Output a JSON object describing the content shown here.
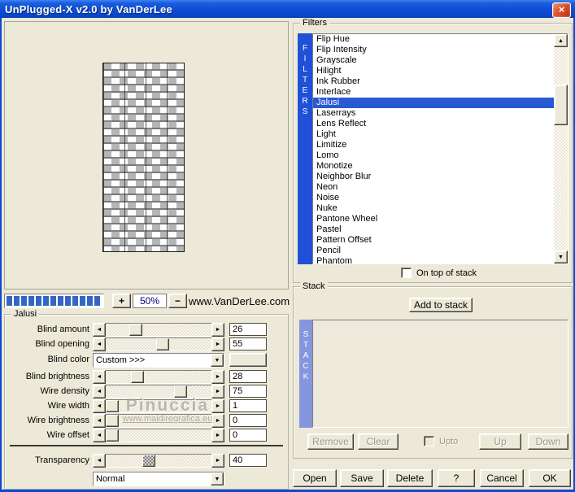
{
  "window": {
    "title": "UnPlugged-X v2.0 by VanDerLee",
    "close_glyph": "×"
  },
  "preview": {
    "zoom_in_label": "+",
    "zoom_out_label": "−",
    "zoom_value": "50%",
    "website": "www.VanDerLee.com",
    "progress_percent": 100
  },
  "filters": {
    "legend": "Filters",
    "sidebar_letters": [
      "F",
      "I",
      "L",
      "T",
      "E",
      "R",
      "S"
    ],
    "items": [
      "Flip Hue",
      "Flip Intensity",
      "Grayscale",
      "Hilight",
      "Ink Rubber",
      "Interlace",
      "Jalusi",
      "Laserrays",
      "Lens Reflect",
      "Light",
      "Limitize",
      "Lomo",
      "Monotize",
      "Neighbor Blur",
      "Neon",
      "Noise",
      "Nuke",
      "Pantone Wheel",
      "Pastel",
      "Pattern Offset",
      "Pencil",
      "Phantom"
    ],
    "selected_index": 6,
    "selected": "Jalusi",
    "on_top_label": "On top of stack",
    "on_top_checked": false,
    "scroll_up_glyph": "▲",
    "scroll_down_glyph": "▼"
  },
  "stack": {
    "legend": "Stack",
    "add_button_label": "Add to stack",
    "sidebar_letters": [
      "S",
      "T",
      "A",
      "C",
      "K"
    ],
    "items": [],
    "remove_label": "Remove",
    "clear_label": "Clear",
    "upto_label": "Upto",
    "upto_checked": false,
    "up_label": "Up",
    "down_label": "Down"
  },
  "jalusi": {
    "legend": "Jalusi",
    "params": [
      {
        "label": "Blind amount",
        "type": "slider",
        "value": "26",
        "pos": 26
      },
      {
        "label": "Blind opening",
        "type": "slider",
        "value": "55",
        "pos": 55
      },
      {
        "label": "Blind color",
        "type": "dropdown",
        "value": "Custom >>>"
      },
      {
        "label": "Blind brightness",
        "type": "slider",
        "value": "28",
        "pos": 28
      },
      {
        "label": "Wire density",
        "type": "slider",
        "value": "75",
        "pos": 75
      },
      {
        "label": "Wire width",
        "type": "slider",
        "value": "1",
        "pos": 0
      },
      {
        "label": "Wire brightness",
        "type": "slider",
        "value": "0",
        "pos": 0
      },
      {
        "label": "Wire offset",
        "type": "slider",
        "value": "0",
        "pos": 0
      }
    ],
    "transparency": {
      "label": "Transparency",
      "value": "40",
      "pos": 40
    },
    "blend_mode": "Normal",
    "arrow_left_glyph": "◄",
    "arrow_right_glyph": "►",
    "dropdown_arrow_glyph": "▼"
  },
  "actions": [
    "Open",
    "Save",
    "Delete",
    "?",
    "Cancel",
    "OK"
  ],
  "watermark": {
    "line1": "Pinuccia",
    "line2": "www.maidiregrafica.eu"
  },
  "colors": {
    "dialog_bg": "#ece9d8",
    "titlebar_blue": "#0d4ed6",
    "close_red": "#c93a1c",
    "filters_bar_blue": "#2050d8",
    "selection_blue": "#2859d2",
    "stack_bar_blue": "#8496dd",
    "progress_blue": "#3565c4",
    "zoom_text_navy": "#000080"
  }
}
